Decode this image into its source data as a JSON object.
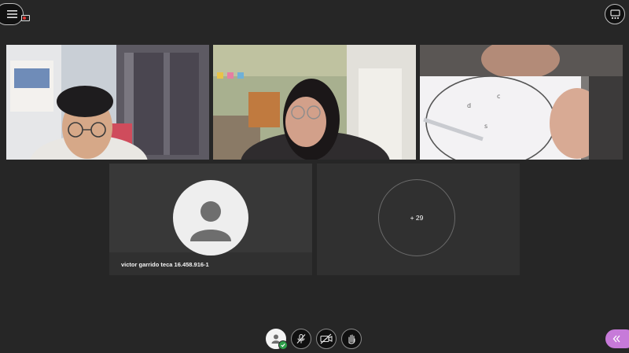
{
  "app": {
    "menu_button_icon": "hamburger-icon",
    "layout_button_icon": "grid-layout-icon",
    "recording_badge_color": "#e53935"
  },
  "participants": {
    "video_tiles": [
      {
        "icon": "video-feed-man-glasses"
      },
      {
        "icon": "video-feed-woman-glasses"
      },
      {
        "icon": "video-feed-drawing-circle"
      }
    ],
    "no_video_tile": {
      "name": "victor garrido teca 16.458.916-1",
      "avatar_icon": "default-avatar-icon"
    },
    "overflow_tile": {
      "count_label": "+ 29"
    }
  },
  "controls": {
    "my_status": {
      "icon": "my-avatar-icon",
      "status_icon": "check-icon",
      "status_color": "#2e9f4a"
    },
    "mic": {
      "icon": "mic-off-icon"
    },
    "camera": {
      "icon": "camera-off-icon"
    },
    "hand": {
      "icon": "raise-hand-icon"
    }
  },
  "collaborate_panel": {
    "icon": "double-chevron-left-icon",
    "color": "#c77ad9"
  }
}
